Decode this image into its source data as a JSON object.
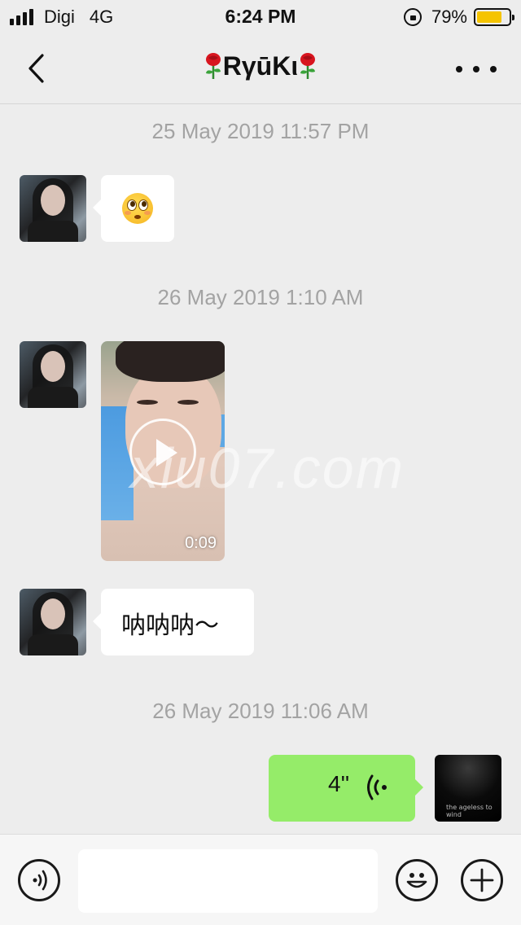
{
  "status_bar": {
    "carrier": "Digi",
    "network": "4G",
    "time": "6:24 PM",
    "battery_percent": "79%",
    "battery_level": 0.79,
    "icons": [
      "signal-icon",
      "orientation-lock-icon",
      "battery-icon"
    ]
  },
  "nav": {
    "title": "RγūKι",
    "title_decoration_icon": "rose-icon",
    "back_icon": "chevron-left-icon",
    "more_icon": "more-dots-icon"
  },
  "messages": {
    "ts1": "25 May 2019 11:57 PM",
    "msg1_emoji": "flushed-face-emoji",
    "ts2": "26 May 2019 1:10 AM",
    "msg2_video_duration": "0:09",
    "msg3_text": "呐呐呐～",
    "ts3": "26 May 2019 11:06 AM",
    "msg4_voice_duration": "4''",
    "watermark": "xiu07.com",
    "self_avatar_text": "the ageless to wind"
  },
  "input_bar": {
    "voice_icon": "voice-mode-icon",
    "message_placeholder": "",
    "emoji_icon": "smiley-icon",
    "add_icon": "plus-icon"
  },
  "colors": {
    "background": "#ededed",
    "sent_bubble": "#95ec69",
    "received_bubble": "#ffffff",
    "timestamp": "#a3a3a3",
    "battery": "#f5c400"
  }
}
